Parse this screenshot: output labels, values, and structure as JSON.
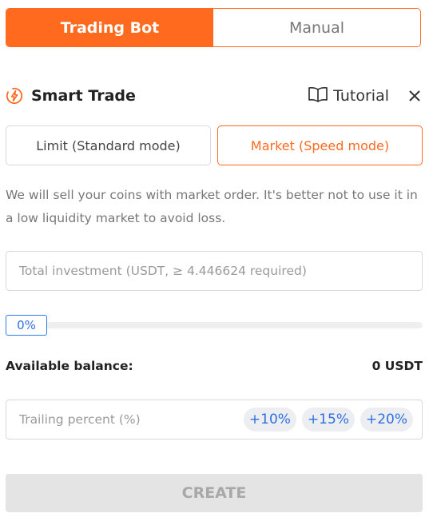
{
  "tabs": {
    "trading_bot": "Trading Bot",
    "manual": "Manual"
  },
  "header": {
    "title": "Smart Trade",
    "tutorial": "Tutorial"
  },
  "modes": {
    "limit": "Limit (Standard mode)",
    "market": "Market (Speed mode)"
  },
  "description": "We will sell your coins with market order. It's better not to use it in a low liquidity market to avoid loss.",
  "investment": {
    "placeholder": "Total investment (USDT, ≥ 4.446624 required)",
    "value": ""
  },
  "slider": {
    "percent_label": "0%",
    "value": 0
  },
  "balance": {
    "label": "Available balance:",
    "value": "0 USDT"
  },
  "trailing": {
    "placeholder": "Trailing percent (%)",
    "value": "",
    "chips": [
      "+10%",
      "+15%",
      "+20%"
    ]
  },
  "create_label": "CREATE",
  "colors": {
    "accent": "#ff6a1f",
    "link": "#2f6fe0",
    "disabled_bg": "#e4e4e4"
  }
}
